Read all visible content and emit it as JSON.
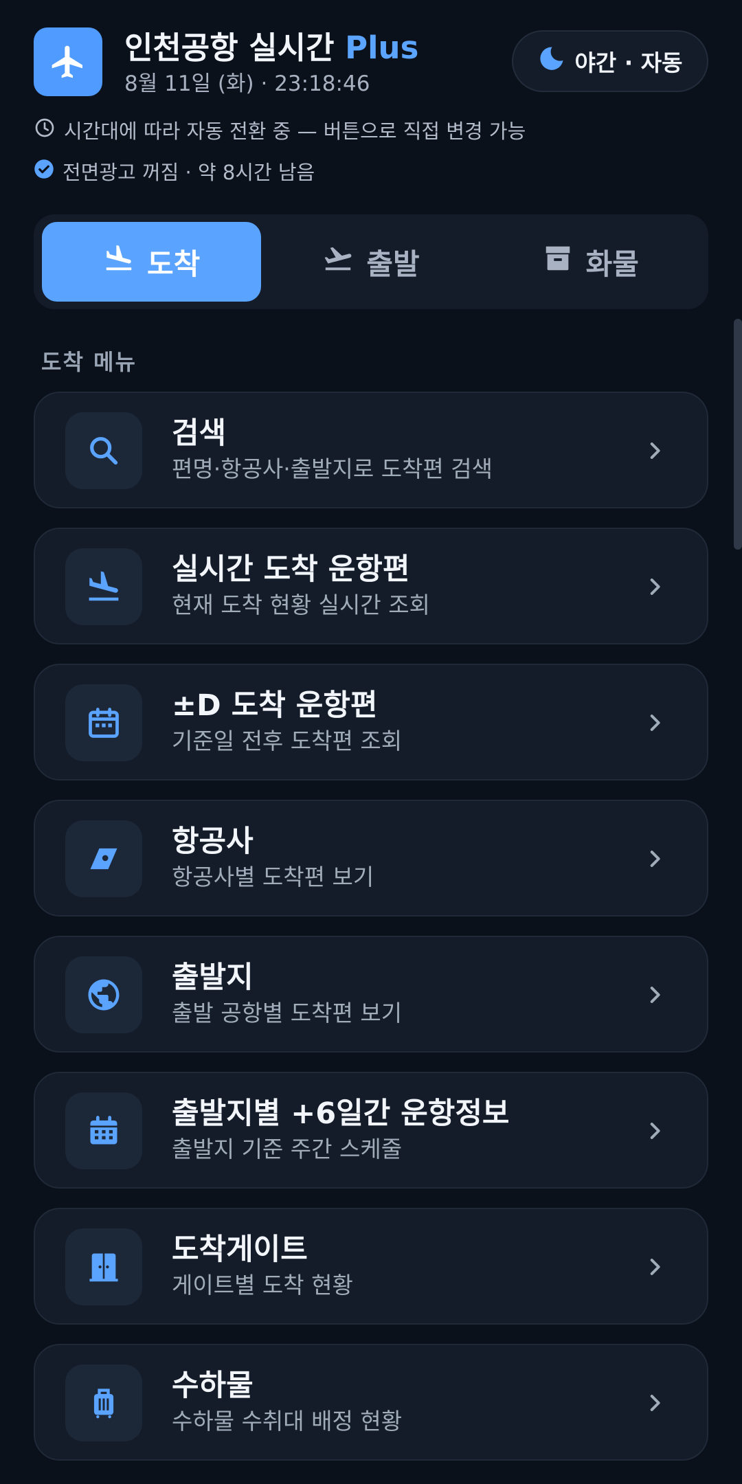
{
  "header": {
    "title": "인천공항 실시간",
    "title_accent": "Plus",
    "datetime": "8월 11일 (화) · 23:18:46",
    "theme_button_label": "야간 · 자동"
  },
  "info": {
    "auto_switch": "시간대에 따라 자동 전환 중 — 버튼으로 직접 변경 가능",
    "ad_status": "전면광고 꺼짐 · 약 8시간 남음"
  },
  "tabs": [
    {
      "label": "도착",
      "active": true
    },
    {
      "label": "출발",
      "active": false
    },
    {
      "label": "화물",
      "active": false
    }
  ],
  "section_label": "도착 메뉴",
  "menu": [
    {
      "title": "검색",
      "subtitle": "편명·항공사·출발지로 도착편 검색",
      "icon": "search-icon"
    },
    {
      "title": "실시간 도착 운항편",
      "subtitle": "현재 도착 현황 실시간 조회",
      "icon": "plane-landing-icon"
    },
    {
      "title": "±D 도착 운항편",
      "subtitle": "기준일 전후 도착편 조회",
      "icon": "calendar-icon"
    },
    {
      "title": "항공사",
      "subtitle": "항공사별 도착편 보기",
      "icon": "airline-tail-icon"
    },
    {
      "title": "출발지",
      "subtitle": "출발 공항별 도착편 보기",
      "icon": "globe-icon"
    },
    {
      "title": "출발지별 +6일간 운항정보",
      "subtitle": "출발지 기준 주간 스케줄",
      "icon": "calendar-month-icon"
    },
    {
      "title": "도착게이트",
      "subtitle": "게이트별 도착 현황",
      "icon": "door-icon"
    },
    {
      "title": "수하물",
      "subtitle": "수하물 수취대 배정 현황",
      "icon": "luggage-icon"
    }
  ],
  "colors": {
    "accent": "#5aa3ff",
    "background": "#0b111b",
    "card": "#141c29"
  }
}
